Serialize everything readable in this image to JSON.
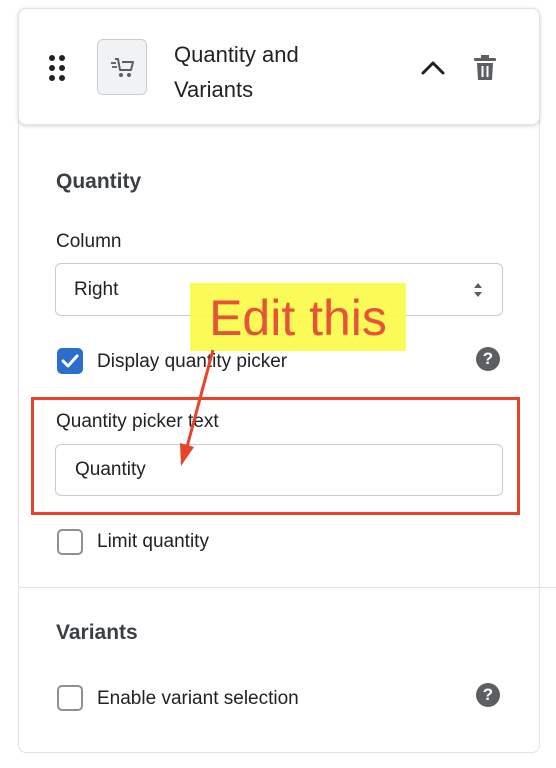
{
  "header": {
    "title": "Quantity and Variants"
  },
  "quantity_section": {
    "title": "Quantity",
    "column_label": "Column",
    "column_value": "Right",
    "display_picker_label": "Display quantity picker",
    "display_picker_checked": true,
    "picker_text_label": "Quantity picker text",
    "picker_text_value": "Quantity",
    "limit_quantity_label": "Limit quantity",
    "limit_quantity_checked": false
  },
  "variants_section": {
    "title": "Variants",
    "enable_variant_label": "Enable variant selection",
    "enable_variant_checked": false
  },
  "annotation": {
    "text": "Edit this"
  },
  "help_glyph": "?",
  "colors": {
    "accent": "#2c6ecb",
    "annotation_red": "#e8442a",
    "annotation_yellow": "#fbfb4a"
  }
}
